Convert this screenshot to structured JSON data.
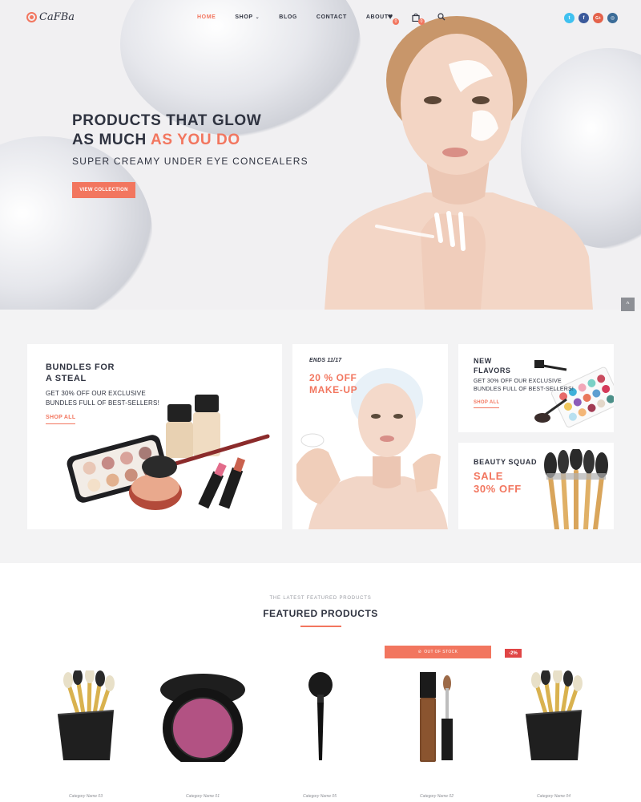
{
  "brand": {
    "name": "CaFBa"
  },
  "nav": {
    "items": [
      {
        "label": "HOME",
        "active": true
      },
      {
        "label": "SHOP",
        "has_dropdown": true
      },
      {
        "label": "BLOG"
      },
      {
        "label": "CONTACT"
      },
      {
        "label": "ABOUT"
      }
    ]
  },
  "header_icons": {
    "wishlist": {
      "icon": "heart-icon",
      "count": "0"
    },
    "cart": {
      "icon": "bag-icon",
      "count": "0"
    },
    "search": {
      "icon": "search-icon"
    }
  },
  "social": [
    {
      "name": "twitter-icon",
      "glyph": "t",
      "color": "#3fc1f0"
    },
    {
      "name": "facebook-icon",
      "glyph": "f",
      "color": "#3b5a9b"
    },
    {
      "name": "google-plus-icon",
      "glyph": "G+",
      "color": "#e4624b"
    },
    {
      "name": "instagram-icon",
      "glyph": "◎",
      "color": "#3c6c98"
    }
  ],
  "hero": {
    "title_line1": "PRODUCTS THAT GLOW",
    "title_line2_plain": "AS MUCH ",
    "title_line2_accent": "AS YOU DO",
    "subtitle": "SUPER CREAMY UNDER EYE CONCEALERS",
    "button": "VIEW COLLECTION"
  },
  "promos": {
    "bundles": {
      "title_line1": "BUNDLES FOR",
      "title_line2": "A STEAL",
      "text_line1": "GET 30% OFF OUR EXCLUSIVE",
      "text_line2": "BUNDLES FULL OF BEST-SELLERS!",
      "link": "SHOP ALL"
    },
    "makeup": {
      "ends": "ENDS 11/17",
      "offer_line1": "20 % OFF",
      "offer_line2": "MAKE-UP"
    },
    "flavors": {
      "title_line1": "NEW",
      "title_line2": "FLAVORS",
      "text_line1": "GET 30% OFF OUR EXCLUSIVE",
      "text_line2": "BUNDLES FULL OF BEST-SELLERS!",
      "link": "SHOP ALL"
    },
    "squad": {
      "title": "BEAUTY SQUAD",
      "offer_line1": "SALE",
      "offer_line2": "30% OFF"
    }
  },
  "featured": {
    "kicker": "THE LATEST FEATURED PRODUCTS",
    "title": "FEATURED PRODUCTS",
    "out_of_stock": "OUT OF STOCK",
    "sale_badge": "-2%",
    "products": [
      {
        "category": "Category Name 03",
        "image": "brush-holder"
      },
      {
        "category": "Category Name 01",
        "image": "blush-compact"
      },
      {
        "category": "Category Name 05",
        "image": "makeup-brush"
      },
      {
        "category": "Category Name 02",
        "image": "lip-gloss"
      },
      {
        "category": "Category Name 04",
        "image": "brush-holder"
      }
    ]
  },
  "colors": {
    "accent": "#f2765f",
    "dark": "#2f3340",
    "bg_light": "#f3f3f4"
  }
}
